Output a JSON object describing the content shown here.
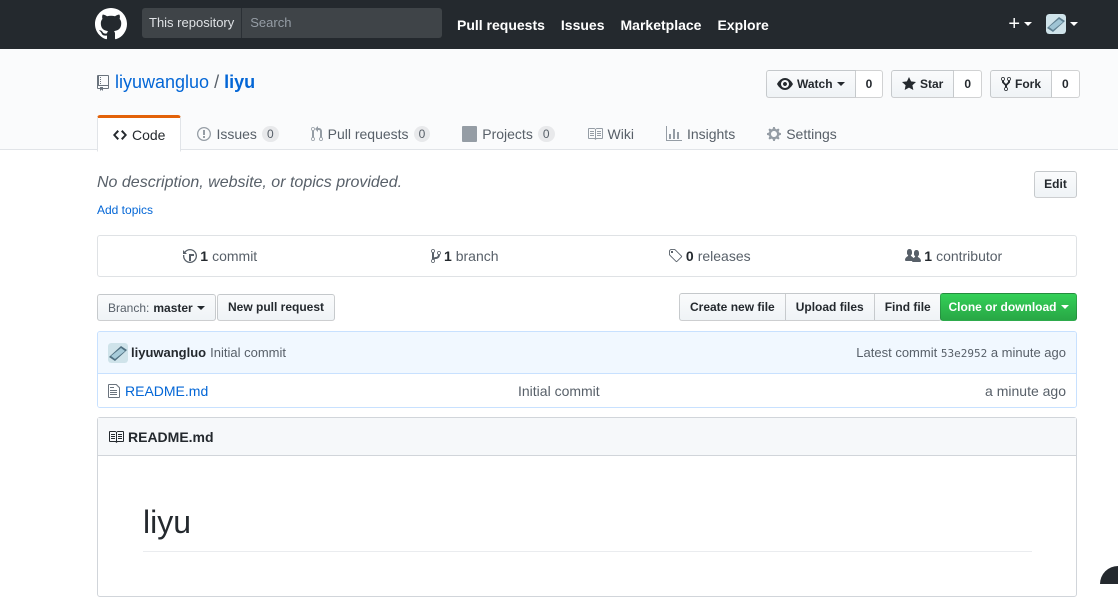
{
  "header": {
    "search_scope": "This repository",
    "search_placeholder": "Search",
    "nav": [
      "Pull requests",
      "Issues",
      "Marketplace",
      "Explore"
    ],
    "plus_label": "+"
  },
  "repo": {
    "owner": "liyuwangluo",
    "separator": "/",
    "name": "liyu"
  },
  "actions": {
    "watch_label": "Watch",
    "watch_count": "0",
    "star_label": "Star",
    "star_count": "0",
    "fork_label": "Fork",
    "fork_count": "0"
  },
  "tabs": {
    "code": "Code",
    "issues": "Issues",
    "issues_count": "0",
    "pulls": "Pull requests",
    "pulls_count": "0",
    "projects": "Projects",
    "projects_count": "0",
    "wiki": "Wiki",
    "insights": "Insights",
    "settings": "Settings"
  },
  "description": {
    "text": "No description, website, or topics provided.",
    "add_topics": "Add topics",
    "edit_label": "Edit"
  },
  "summary": {
    "commits_num": "1",
    "commits_label": "commit",
    "branches_num": "1",
    "branches_label": "branch",
    "releases_num": "0",
    "releases_label": "releases",
    "contributors_num": "1",
    "contributors_label": "contributor"
  },
  "filenav": {
    "branch_label": "Branch:",
    "branch_value": "master",
    "new_pr": "New pull request",
    "create_file": "Create new file",
    "upload_files": "Upload files",
    "find_file": "Find file",
    "clone": "Clone or download"
  },
  "commit": {
    "author": "liyuwangluo",
    "message": "Initial commit",
    "latest_label": "Latest commit",
    "sha": "53e2952",
    "age": "a minute ago"
  },
  "files": [
    {
      "name": "README.md",
      "message": "Initial commit",
      "age": "a minute ago"
    }
  ],
  "readme": {
    "header": "README.md",
    "heading": "liyu"
  },
  "colors": {
    "header_bg": "#24292e",
    "link": "#0366d6",
    "selected_tab_accent": "#e36209",
    "clone_green": "#28a745",
    "commit_bg": "#f1f8ff"
  }
}
